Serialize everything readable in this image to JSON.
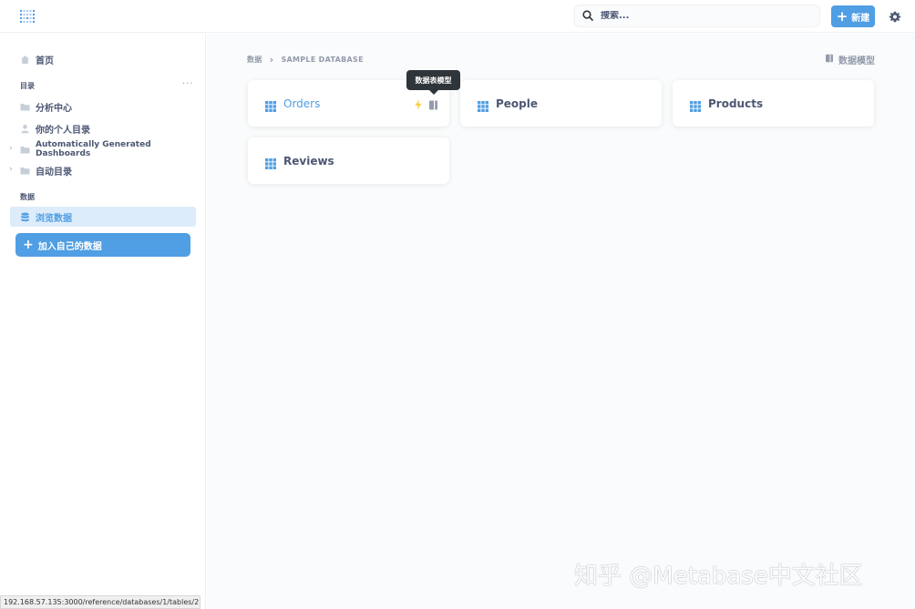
{
  "header": {
    "search_placeholder": "搜索...",
    "new_button_label": "新建",
    "icons": [
      "metabase-logo",
      "search-icon",
      "plus-icon",
      "gear-icon"
    ]
  },
  "sidebar": {
    "home_label": "首页",
    "collections_label": "目录",
    "collections": [
      {
        "label": "分析中心",
        "icon": "folder-icon"
      },
      {
        "label": "你的个人目录",
        "icon": "person-icon"
      },
      {
        "label": "Automatically Generated Dashboards",
        "icon": "folder-icon"
      },
      {
        "label": "自动目录",
        "icon": "folder-icon"
      }
    ],
    "data_label": "数据",
    "browse_data_label": "浏览数据",
    "add_data_label": "加入自己的数据"
  },
  "main": {
    "breadcrumb": [
      "数据",
      "SAMPLE DATABASE"
    ],
    "model_link_label": "数据模型",
    "tooltip": "数据表模型",
    "tables": [
      {
        "name": "Orders"
      },
      {
        "name": "People"
      },
      {
        "name": "Products"
      },
      {
        "name": "Reviews"
      }
    ]
  },
  "colors": {
    "brand": "#509ee3",
    "text": "#4c5773",
    "muted": "#949aab",
    "lightning": "#f9cf48"
  },
  "watermark": "知乎 @Metabase中文社区",
  "status_url": "192.168.57.135:3000/reference/databases/1/tables/2"
}
